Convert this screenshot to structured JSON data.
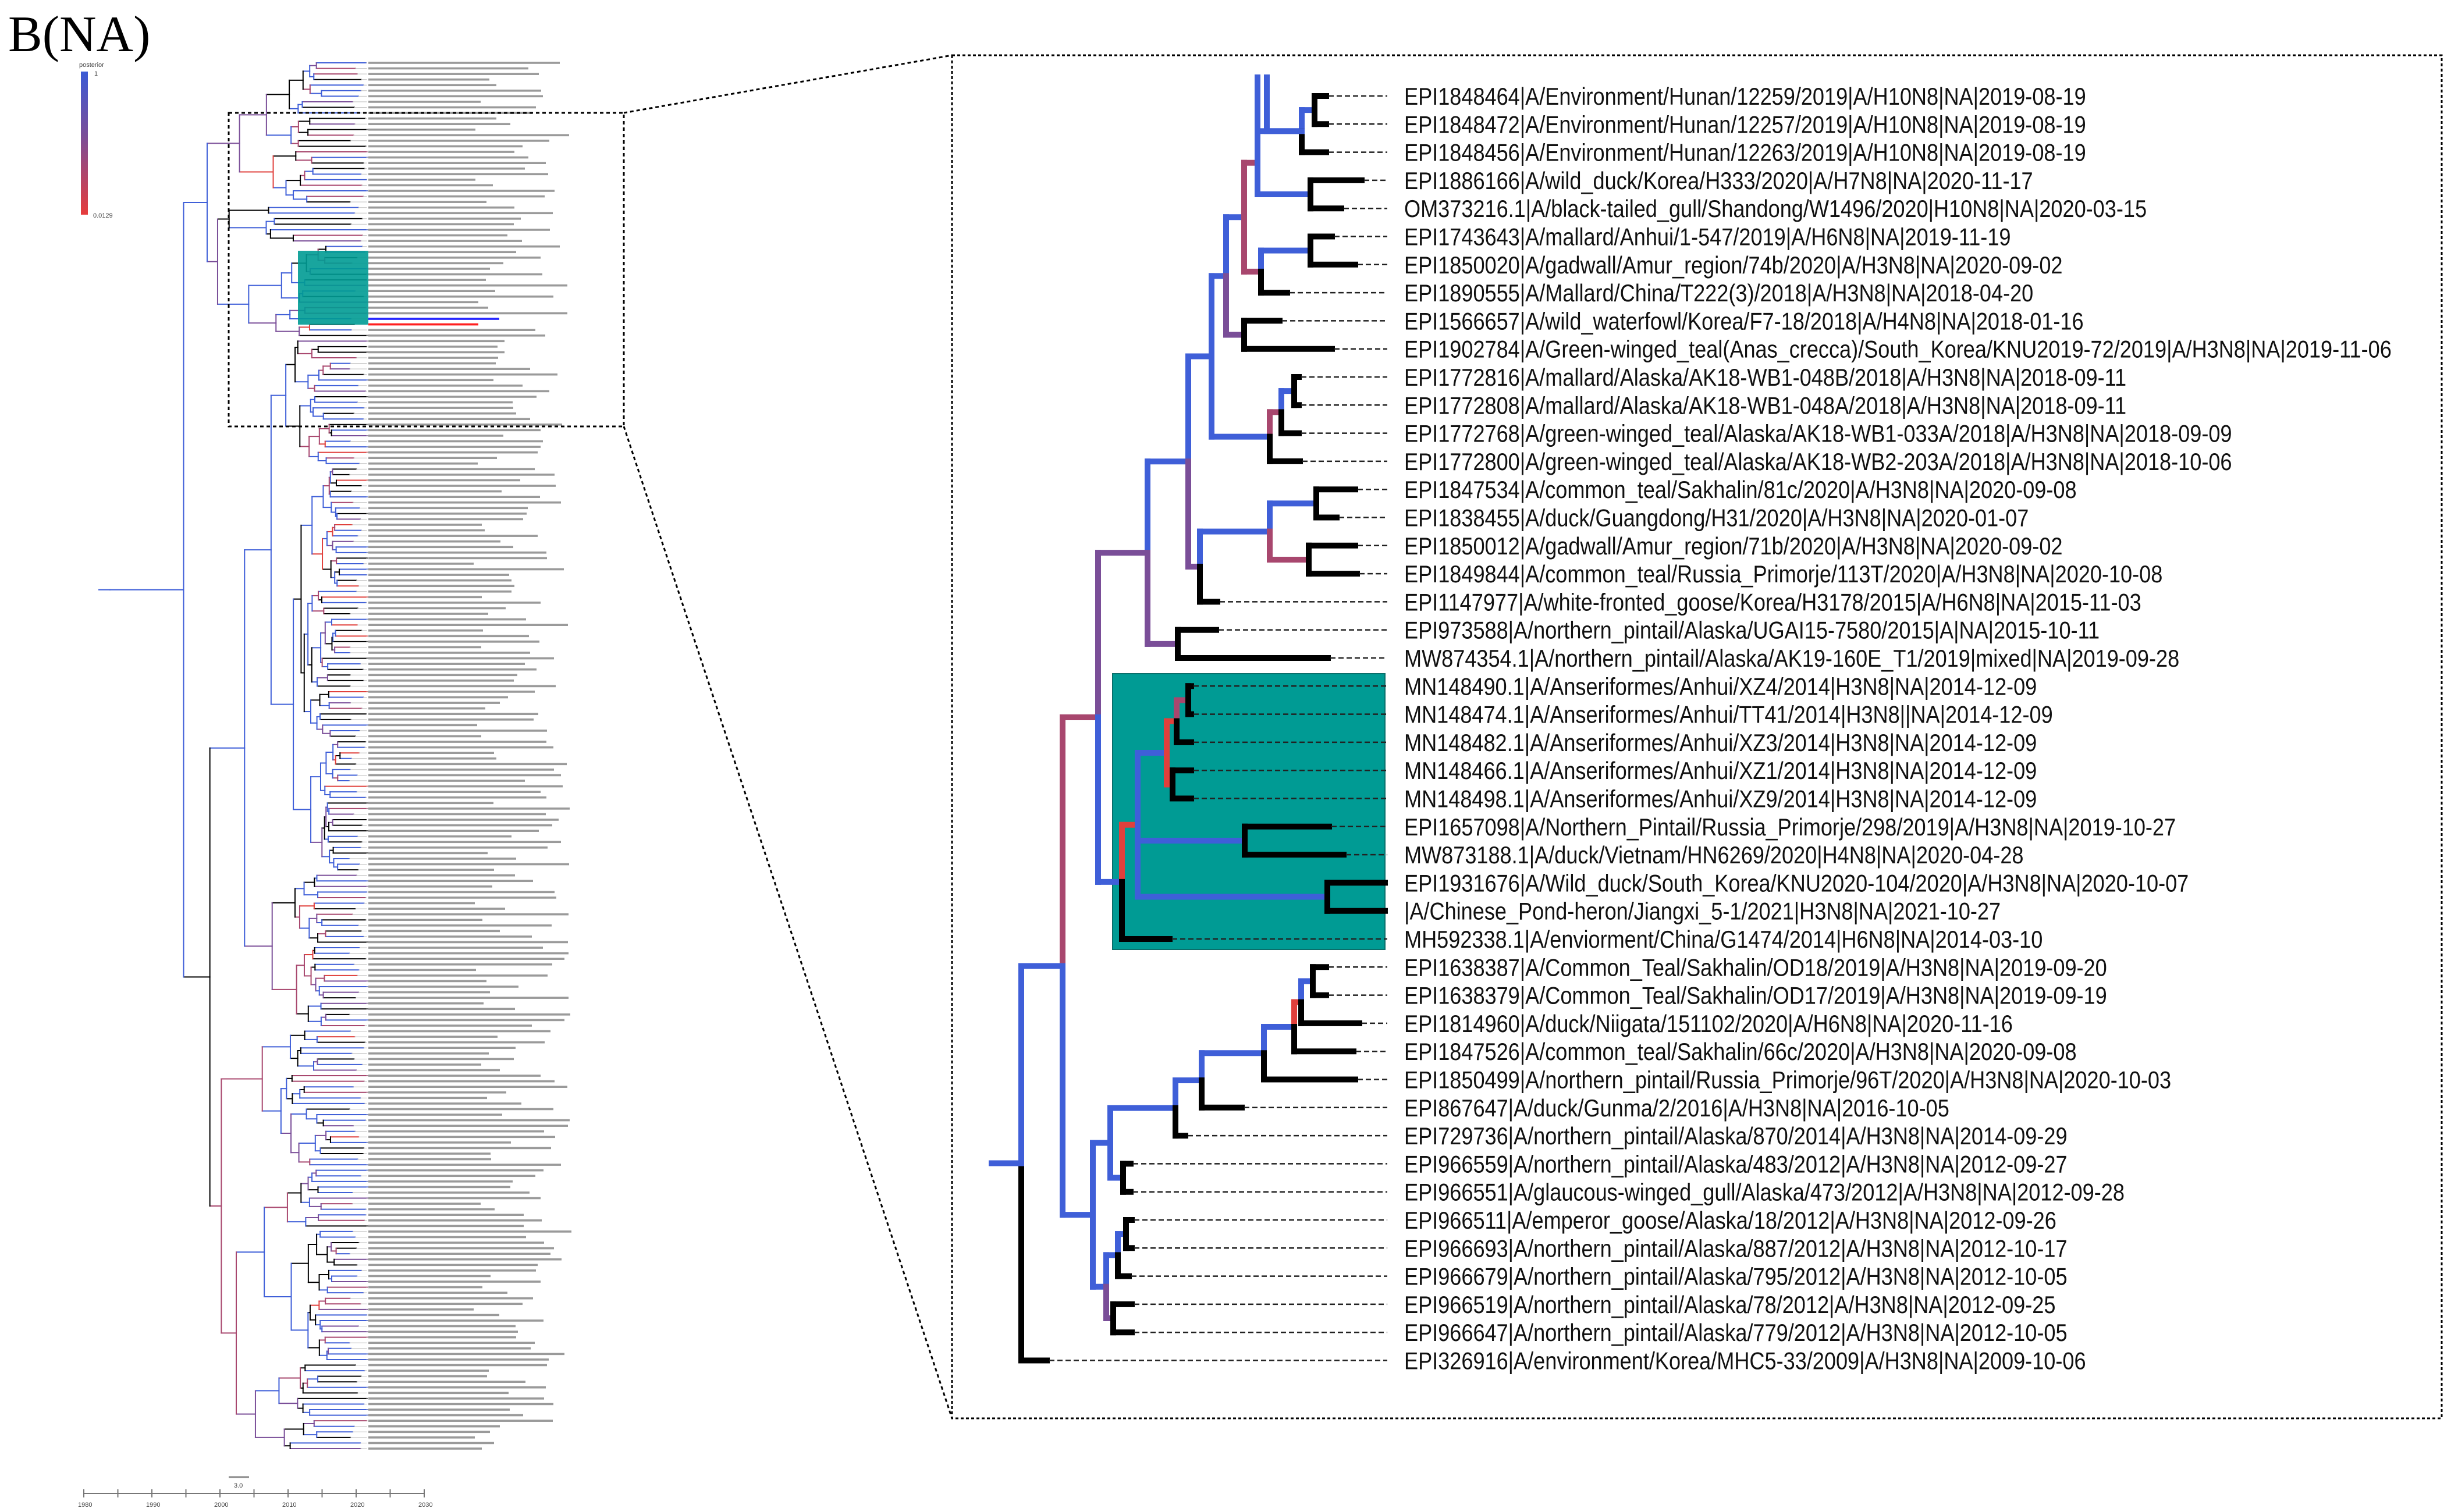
{
  "figure": {
    "panel_label": "B(NA)"
  },
  "legend": {
    "title": "posterior",
    "max_label": "1",
    "min_label": "0.0129",
    "colors": {
      "high": "#3a5ad6",
      "mid": "#7a4e98",
      "low": "#e63c3c"
    }
  },
  "time_axis": {
    "ticks": [
      "1980",
      "1990",
      "2000",
      "2010",
      "2020",
      "2030"
    ],
    "scale_bar_label": "3.0"
  },
  "colors": {
    "branch_blue": "#3f5fd8",
    "branch_purple": "#7a4e98",
    "branch_mauve": "#a8476e",
    "branch_red": "#e0403c",
    "branch_black": "#000000",
    "highlight_clade": "#009b94",
    "label_blue": "#2626ff",
    "label_red": "#ff2020"
  },
  "zoom_panel": {
    "leaves": [
      {
        "label": "EPI1848464|A/Environment/Hunan/12259/2019|A/H10N8|NA|2019-08-19"
      },
      {
        "label": "EPI1848472|A/Environment/Hunan/12257/2019|A/H10N8|NA|2019-08-19"
      },
      {
        "label": "EPI1848456|A/Environment/Hunan/12263/2019|A/H10N8|NA|2019-08-19"
      },
      {
        "label": "EPI1886166|A/wild_duck/Korea/H333/2020|A/H7N8|NA|2020-11-17"
      },
      {
        "label": "OM373216.1|A/black-tailed_gull/Shandong/W1496/2020|H10N8|NA|2020-03-15"
      },
      {
        "label": "EPI1743643|A/mallard/Anhui/1-547/2019|A/H6N8|NA|2019-11-19"
      },
      {
        "label": "EPI1850020|A/gadwall/Amur_region/74b/2020|A/H3N8|NA|2020-09-02"
      },
      {
        "label": "EPI1890555|A/Mallard/China/T222(3)/2018|A/H3N8|NA|2018-04-20"
      },
      {
        "label": "EPI1566657|A/wild_waterfowl/Korea/F7-18/2018|A/H4N8|NA|2018-01-16"
      },
      {
        "label": "EPI1902784|A/Green-winged_teal(Anas_crecca)/South_Korea/KNU2019-72/2019|A/H3N8|NA|2019-11-06"
      },
      {
        "label": "EPI1772816|A/mallard/Alaska/AK18-WB1-048B/2018|A/H3N8|NA|2018-09-11"
      },
      {
        "label": "EPI1772808|A/mallard/Alaska/AK18-WB1-048A/2018|A/H3N8|NA|2018-09-11"
      },
      {
        "label": "EPI1772768|A/green-winged_teal/Alaska/AK18-WB1-033A/2018|A/H3N8|NA|2018-09-09"
      },
      {
        "label": "EPI1772800|A/green-winged_teal/Alaska/AK18-WB2-203A/2018|A/H3N8|NA|2018-10-06"
      },
      {
        "label": "EPI1847534|A/common_teal/Sakhalin/81c/2020|A/H3N8|NA|2020-09-08"
      },
      {
        "label": "EPI1838455|A/duck/Guangdong/H31/2020|A/H3N8|NA|2020-01-07"
      },
      {
        "label": "EPI1850012|A/gadwall/Amur_region/71b/2020|A/H3N8|NA|2020-09-02"
      },
      {
        "label": "EPI1849844|A/common_teal/Russia_Primorje/113T/2020|A/H3N8|NA|2020-10-08"
      },
      {
        "label": "EPI1147977|A/white-fronted_goose/Korea/H3178/2015|A/H6N8|NA|2015-11-03"
      },
      {
        "label": "EPI973588|A/northern_pintail/Alaska/UGAI15-7580/2015|A|NA|2015-10-11"
      },
      {
        "label": "MW874354.1|A/northern_pintail/Alaska/AK19-160E_T1/2019|mixed|NA|2019-09-28"
      },
      {
        "label": "MN148490.1|A/Anseriformes/Anhui/XZ4/2014|H3N8|NA|2014-12-09"
      },
      {
        "label": "MN148474.1|A/Anseriformes/Anhui/TT41/2014|H3N8||NA|2014-12-09"
      },
      {
        "label": "MN148482.1|A/Anseriformes/Anhui/XZ3/2014|H3N8|NA|2014-12-09"
      },
      {
        "label": "MN148466.1|A/Anseriformes/Anhui/XZ1/2014|H3N8|NA|2014-12-09"
      },
      {
        "label": "MN148498.1|A/Anseriformes/Anhui/XZ9/2014|H3N8|NA|2014-12-09"
      },
      {
        "label": "EPI1657098|A/Northern_Pintail/Russia_Primorje/298/2019|A/H3N8|NA|2019-10-27"
      },
      {
        "label": "MW873188.1|A/duck/Vietnam/HN6269/2020|H4N8|NA|2020-04-28"
      },
      {
        "label": "EPI1931676|A/Wild_duck/South_Korea/KNU2020-104/2020|A/H3N8|NA|2020-10-07",
        "highlight": "blue"
      },
      {
        "label": "|A/Chinese_Pond-heron/Jiangxi_5-1/2021|H3N8|NA|2021-10-27",
        "highlight": "red"
      },
      {
        "label": "MH592338.1|A/enviorment/China/G1474/2014|H6N8|NA|2014-03-10"
      },
      {
        "label": "EPI1638387|A/Common_Teal/Sakhalin/OD18/2019|A/H3N8|NA|2019-09-20"
      },
      {
        "label": "EPI1638379|A/Common_Teal/Sakhalin/OD17/2019|A/H3N8|NA|2019-09-19"
      },
      {
        "label": "EPI1814960|A/duck/Niigata/151102/2020|A/H6N8|NA|2020-11-16"
      },
      {
        "label": "EPI1847526|A/common_teal/Sakhalin/66c/2020|A/H3N8|NA|2020-09-08"
      },
      {
        "label": "EPI1850499|A/northern_pintail/Russia_Primorje/96T/2020|A/H3N8|NA|2020-10-03"
      },
      {
        "label": "EPI867647|A/duck/Gunma/2/2016|A/H3N8|NA|2016-10-05"
      },
      {
        "label": "EPI729736|A/northern_pintail/Alaska/870/2014|A/H3N8|NA|2014-09-29"
      },
      {
        "label": "EPI966559|A/northern_pintail/Alaska/483/2012|A/H3N8|NA|2012-09-27"
      },
      {
        "label": "EPI966551|A/glaucous-winged_gull/Alaska/473/2012|A/H3N8|NA|2012-09-28"
      },
      {
        "label": "EPI966511|A/emperor_goose/Alaska/18/2012|A/H3N8|NA|2012-09-26"
      },
      {
        "label": "EPI966693|A/northern_pintail/Alaska/887/2012|A/H3N8|NA|2012-10-17"
      },
      {
        "label": "EPI966679|A/northern_pintail/Alaska/795/2012|A/H3N8|NA|2012-10-05"
      },
      {
        "label": "EPI966519|A/northern_pintail/Alaska/78/2012|A/H3N8|NA|2012-09-25"
      },
      {
        "label": "EPI966647|A/northern_pintail/Alaska/779/2012|A/H3N8|NA|2012-10-05"
      },
      {
        "label": "EPI326916|A/environment/Korea/MHC5-33/2009|A/H3N8|NA|2009-10-06"
      }
    ]
  }
}
